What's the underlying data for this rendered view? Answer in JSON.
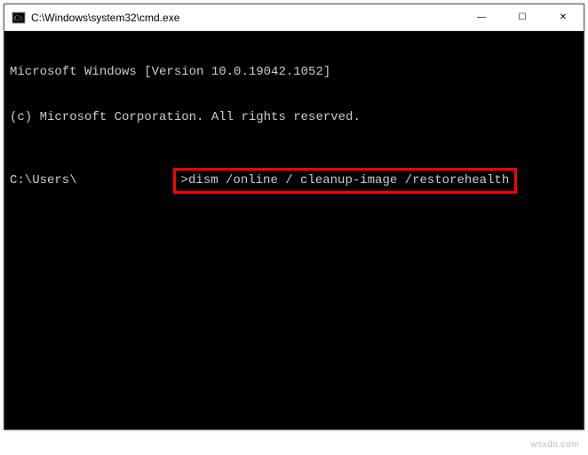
{
  "window": {
    "title": "C:\\Windows\\system32\\cmd.exe"
  },
  "controls": {
    "minimize": "—",
    "maximize": "☐",
    "close": "✕"
  },
  "terminal": {
    "line1": "Microsoft Windows [Version 10.0.19042.1052]",
    "line2": "(c) Microsoft Corporation. All rights reserved.",
    "prompt_prefix": "C:\\Users\\",
    "command": ">dism /online / cleanup-image /restorehealth"
  },
  "watermark": "wsxdn.com"
}
